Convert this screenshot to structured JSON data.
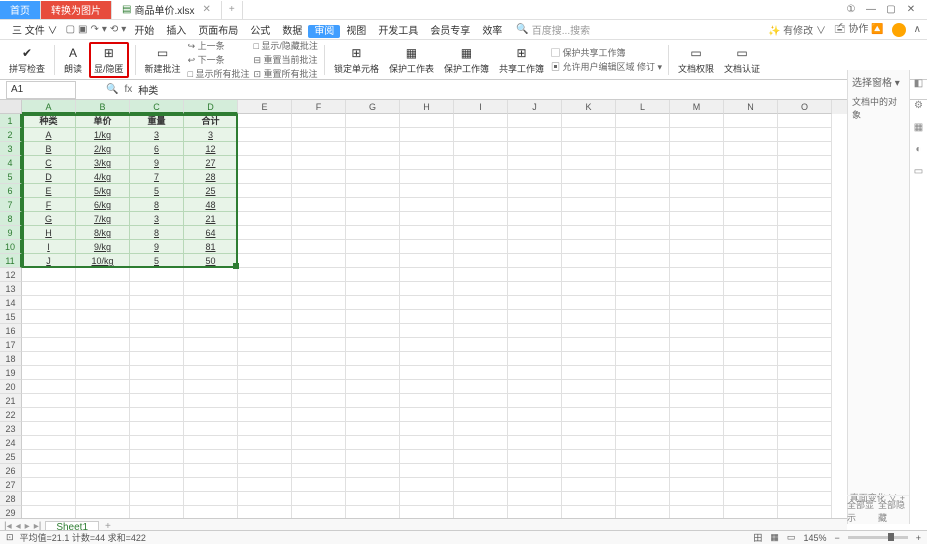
{
  "tabs": {
    "home": "首页",
    "pdf": "转换为图片",
    "file": "商品单价.xlsx",
    "close": "✕",
    "plus": "+"
  },
  "win": {
    "badge": "①"
  },
  "menu": {
    "file": "三 文件 ∨",
    "items": [
      "开始",
      "插入",
      "页面布局",
      "公式",
      "数据",
      "审阅",
      "视图",
      "开发工具",
      "会员专享",
      "效率"
    ],
    "active_index": 5,
    "search_icon": "🔍",
    "search_ph": "百度搜...搜索",
    "premium": "✨ 有修改 ∨",
    "coop": "🖆 协作 🔼"
  },
  "qat": [
    "▢",
    "▣",
    "↷",
    "▾",
    "⟲",
    "▾"
  ],
  "ribbon": {
    "spell": {
      "icon": "✔",
      "label": "拼写检查"
    },
    "read": {
      "icon": "A",
      "label": "朗读"
    },
    "highlighted": {
      "icon": "⊞",
      "label": "显/隐匿"
    },
    "newcomment": {
      "icon": "▭",
      "label": "新建批注"
    },
    "grp1": [
      "↪ 上一条",
      "↩ 下一条",
      "□ 显示所有批注"
    ],
    "grp1b": [
      "□ 显示/隐藏批注",
      "⊟ 重置当前批注",
      "⊡ 重置所有批注"
    ],
    "lock": {
      "icon": "⊞",
      "label": "锁定单元格"
    },
    "protect_sheet": {
      "icon": "▦",
      "label": "保护工作表"
    },
    "protect_book": {
      "icon": "▦",
      "label": "保护工作簿"
    },
    "share": {
      "icon": "⊞",
      "label": "共享工作簿"
    },
    "grp2": [
      "▢ 保护共享工作簿",
      "▣ 允许用户编辑区域  修订 ▾"
    ],
    "doc_perm": {
      "icon": "▭",
      "label": "文档权限"
    },
    "doc_auth": {
      "icon": "▭",
      "label": "文档认证"
    }
  },
  "namebox": "A1",
  "fx": {
    "icon": "🔍",
    "label": "fx",
    "value": "种类"
  },
  "columns": [
    "A",
    "B",
    "C",
    "D",
    "E",
    "F",
    "G",
    "H",
    "I",
    "J",
    "K",
    "L",
    "M",
    "N",
    "O"
  ],
  "sel_cols": 4,
  "rows_total": 30,
  "sel_rows": 11,
  "sheet": {
    "headers": [
      "种类",
      "单价",
      "重量",
      "合计"
    ],
    "data": [
      [
        "A",
        "1/kg",
        "3",
        "3"
      ],
      [
        "B",
        "2/kg",
        "6",
        "12"
      ],
      [
        "C",
        "3/kg",
        "9",
        "27"
      ],
      [
        "D",
        "4/kg",
        "7",
        "28"
      ],
      [
        "E",
        "5/kg",
        "5",
        "25"
      ],
      [
        "F",
        "6/kg",
        "8",
        "48"
      ],
      [
        "G",
        "7/kg",
        "3",
        "21"
      ],
      [
        "H",
        "8/kg",
        "8",
        "64"
      ],
      [
        "I",
        "9/kg",
        "9",
        "81"
      ],
      [
        "J",
        "10/kg",
        "5",
        "50"
      ]
    ]
  },
  "side": {
    "title": "选择窗格 ▾",
    "sub": "文档中的对象"
  },
  "side_mid": {
    "label": "真面变化 ∨",
    "plus": "+"
  },
  "side_bottom": {
    "a": "全部显示",
    "b": "全部隐藏"
  },
  "sheet_tab": "Sheet1",
  "sheet_plus": "+",
  "status": {
    "left_icon": "⊡",
    "stats": "平均值=21.1  计数=44  求和=422",
    "view1": "田",
    "view2": "▦",
    "view3": "▭",
    "zoom": "145% ",
    "minus": "−",
    "plus": "+"
  }
}
